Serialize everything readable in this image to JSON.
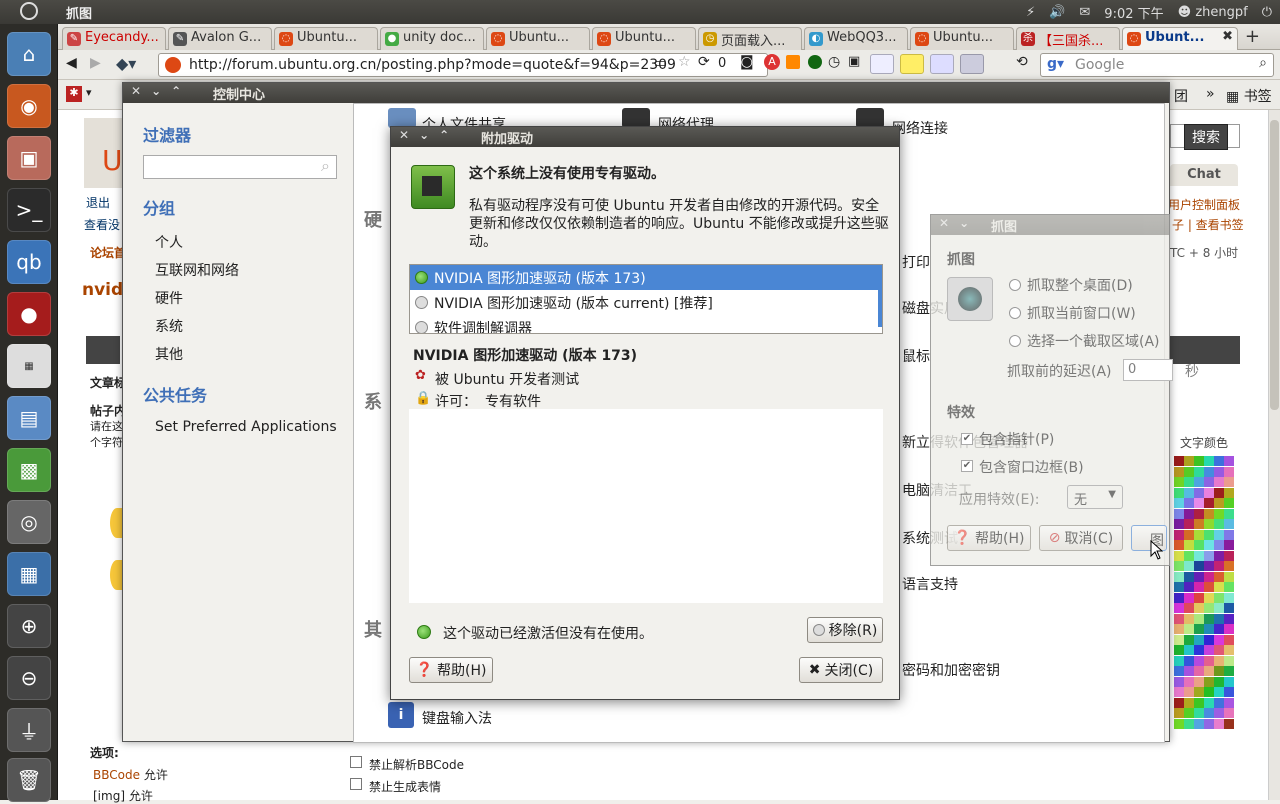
{
  "panel": {
    "app_title": "抓图",
    "time": "9:02 下午",
    "user": "zhengpf"
  },
  "browser": {
    "tabs": [
      "Eyecandy...",
      "Avalon G...",
      "Ubuntu...",
      "unity doc...",
      "Ubuntu...",
      "Ubuntu...",
      "页面载入...",
      "WebQQ3...",
      "Ubuntu...",
      "【三国杀...",
      "Ubunt..."
    ],
    "url": "http://forum.ubuntu.org.cn/posting.php?mode=quote&f=94&p=2309",
    "search_placeholder": "Google",
    "badge_count": "0",
    "bookmarks_label": "书签",
    "bookmark_left": "团"
  },
  "page": {
    "search_btn": "搜索",
    "chat": "Chat",
    "user_panel": "用户控制面板",
    "links": "子 | 查看书签",
    "timezone": "TC + 8 小时",
    "text_color": "文字颜色",
    "left_snips": [
      "退出",
      "查看没",
      "论坛首",
      "nvidi",
      "文章标",
      "帖子内",
      "请在这",
      "个字符"
    ],
    "options_label": "选项:",
    "bbcode": "BBCode",
    "allow1": "允许",
    "img": "[img]",
    "allow2": "允许",
    "chk1": "禁止解析BBCode",
    "chk2": "禁止生成表情"
  },
  "control_center": {
    "title": "控制中心",
    "filter_label": "过滤器",
    "group_label": "分组",
    "groups": [
      "个人",
      "互联网和网络",
      "硬件",
      "系统",
      "其他"
    ],
    "tasks_label": "公共任务",
    "tasks": [
      "Set Preferred Applications"
    ],
    "sections": [
      "硬",
      "系",
      "其"
    ],
    "items": [
      "个人文件共享",
      "网络代理",
      "网络连接",
      "打印",
      "磁盘实用工具",
      "鼠标",
      "新立得软件包管理器",
      "电脑清洁工",
      "系统测试",
      "语言支持",
      "密码和加密密钥",
      "键盘输入法"
    ]
  },
  "driver_dialog": {
    "title": "附加驱动",
    "heading": "这个系统上没有使用专有驱动。",
    "description": "私有驱动程序没有可使 Ubuntu 开发者自由修改的开源代码。安全更新和修改仅仅依赖制造者的响应。Ubuntu 不能修改或提升这些驱动。",
    "drivers": [
      "NVIDIA 图形加速驱动 (版本 173)",
      "NVIDIA 图形加速驱动 (版本 current) [推荐]",
      "软件调制解调器"
    ],
    "detail_title": "NVIDIA 图形加速驱动 (版本 173)",
    "tested_by": "被 Ubuntu 开发者测试",
    "license_label": "许可：",
    "license_value": "专有软件",
    "status": "这个驱动已经激活但没有在使用。",
    "remove_btn": "移除(R)",
    "help_btn": "帮助(H)",
    "close_btn": "关闭(C)"
  },
  "screenshot_dialog": {
    "title": "抓图",
    "section_grab": "抓图",
    "opt_desktop": "抓取整个桌面(D)",
    "opt_window": "抓取当前窗口(W)",
    "opt_area": "选择一个截取区域(A)",
    "delay_label": "抓取前的延迟(A)",
    "delay_value": "0",
    "delay_unit": "秒",
    "effects_label": "特效",
    "chk_pointer": "包含指针(P)",
    "chk_border": "包含窗口边框(B)",
    "apply_effect": "应用特效(E):",
    "effect_value": "无",
    "help_btn": "帮助(H)",
    "cancel_btn": "取消(C)",
    "grab_btn": "抓图(S)"
  }
}
